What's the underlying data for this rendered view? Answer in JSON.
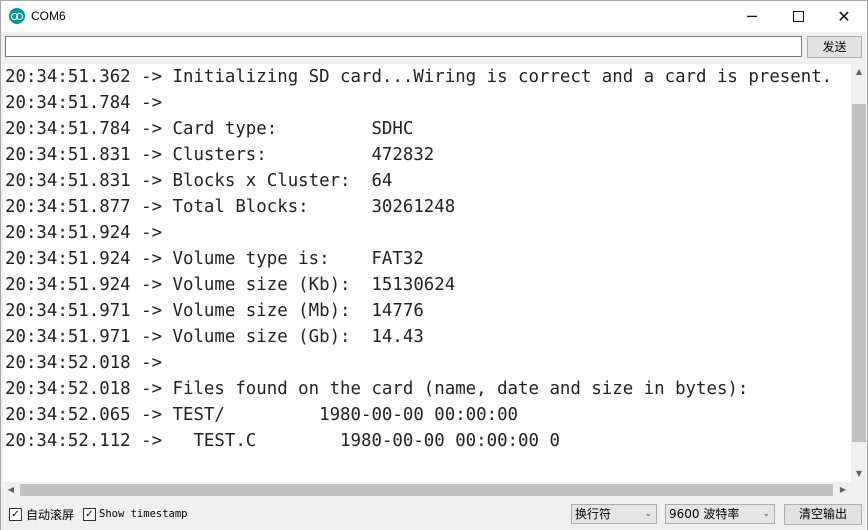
{
  "window": {
    "title": "COM6",
    "minimize": "─",
    "close": "✕"
  },
  "input": {
    "value": "",
    "send_label": "发送"
  },
  "output_lines": [
    "20:34:51.362 -> Initializing SD card...Wiring is correct and a card is present.",
    "20:34:51.784 -> ",
    "20:34:51.784 -> Card type:         SDHC",
    "20:34:51.831 -> Clusters:          472832",
    "20:34:51.831 -> Blocks x Cluster:  64",
    "20:34:51.877 -> Total Blocks:      30261248",
    "20:34:51.924 -> ",
    "20:34:51.924 -> Volume type is:    FAT32",
    "20:34:51.924 -> Volume size (Kb):  15130624",
    "20:34:51.971 -> Volume size (Mb):  14776",
    "20:34:51.971 -> Volume size (Gb):  14.43",
    "20:34:52.018 -> ",
    "20:34:52.018 -> Files found on the card (name, date and size in bytes): ",
    "20:34:52.065 -> TEST/         1980-00-00 00:00:00",
    "20:34:52.112 ->   TEST.C        1980-00-00 00:00:00 0"
  ],
  "status": {
    "autoscroll_label": "自动滚屏",
    "autoscroll_checked": true,
    "timestamp_label": "Show timestamp",
    "timestamp_checked": true,
    "line_ending": "换行符",
    "baud_rate": "9600 波特率",
    "clear_label": "清空输出"
  },
  "colors": {
    "app_icon": "#00979c",
    "window_bg": "#f0f0f0",
    "output_bg": "#ffffff"
  }
}
